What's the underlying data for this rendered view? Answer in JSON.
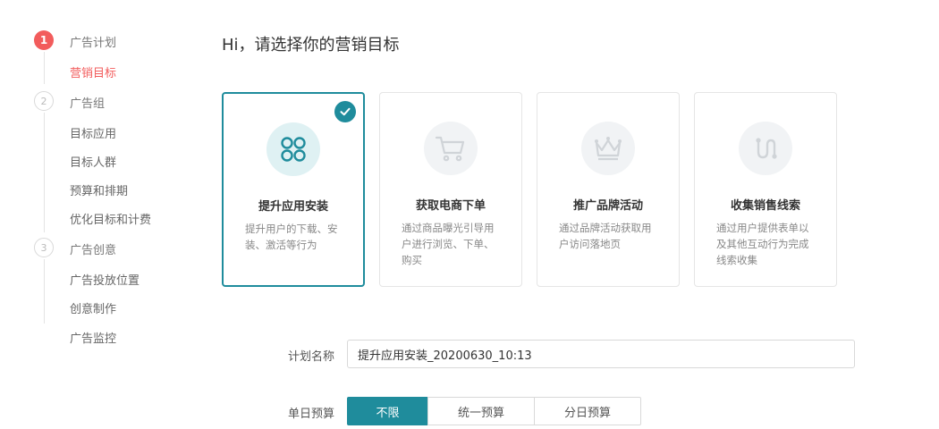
{
  "sidebar": {
    "steps": [
      {
        "number": "1",
        "label": "广告计划",
        "sub": [
          "营销目标"
        ]
      },
      {
        "number": "2",
        "label": "广告组",
        "sub": [
          "目标应用",
          "目标人群",
          "预算和排期",
          "优化目标和计费"
        ]
      },
      {
        "number": "3",
        "label": "广告创意",
        "sub": [
          "广告投放位置",
          "创意制作",
          "广告监控"
        ]
      }
    ]
  },
  "main": {
    "title": "Hi，请选择你的营销目标",
    "cards": [
      {
        "title": "提升应用安装",
        "desc": "提升用户的下载、安装、激活等行为",
        "icon": "app-grid-icon",
        "selected": true
      },
      {
        "title": "获取电商下单",
        "desc": "通过商品曝光引导用户进行浏览、下单、购买",
        "icon": "shopping-cart-icon",
        "selected": false
      },
      {
        "title": "推广品牌活动",
        "desc": "通过品牌活动获取用户访问落地页",
        "icon": "crown-icon",
        "selected": false
      },
      {
        "title": "收集销售线索",
        "desc": "通过用户提供表单以及其他互动行为完成线索收集",
        "icon": "lead-path-icon",
        "selected": false
      }
    ]
  },
  "form": {
    "plan_name_label": "计划名称",
    "plan_name_value": "提升应用安装_20200630_10:13",
    "daily_budget_label": "单日预算",
    "budget_options": [
      "不限",
      "统一预算",
      "分日预算"
    ],
    "budget_selected": "不限"
  },
  "colors": {
    "accent": "#1f8c9c",
    "active_step": "#f25c5c"
  }
}
